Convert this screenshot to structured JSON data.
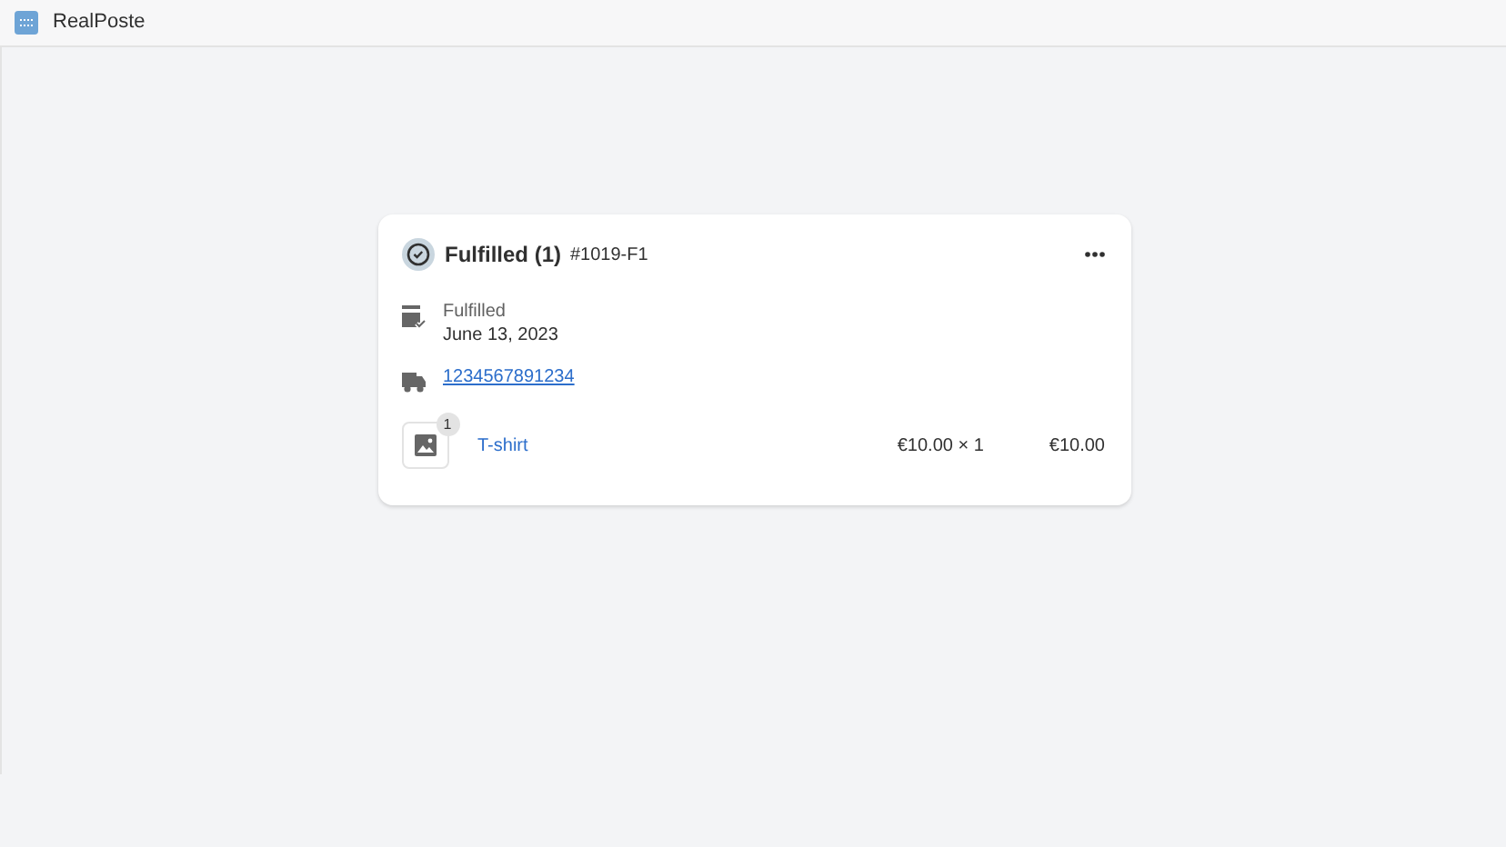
{
  "app": {
    "title": "RealPoste"
  },
  "fulfillment": {
    "status": "Fulfilled (1)",
    "number": "#1019-F1",
    "date_label": "Fulfilled",
    "date": "June 13, 2023",
    "tracking": "1234567891234",
    "items": [
      {
        "quantity": "1",
        "name": "T-shirt",
        "unit_price": "€10.00 × 1",
        "total": "€10.00"
      }
    ]
  }
}
